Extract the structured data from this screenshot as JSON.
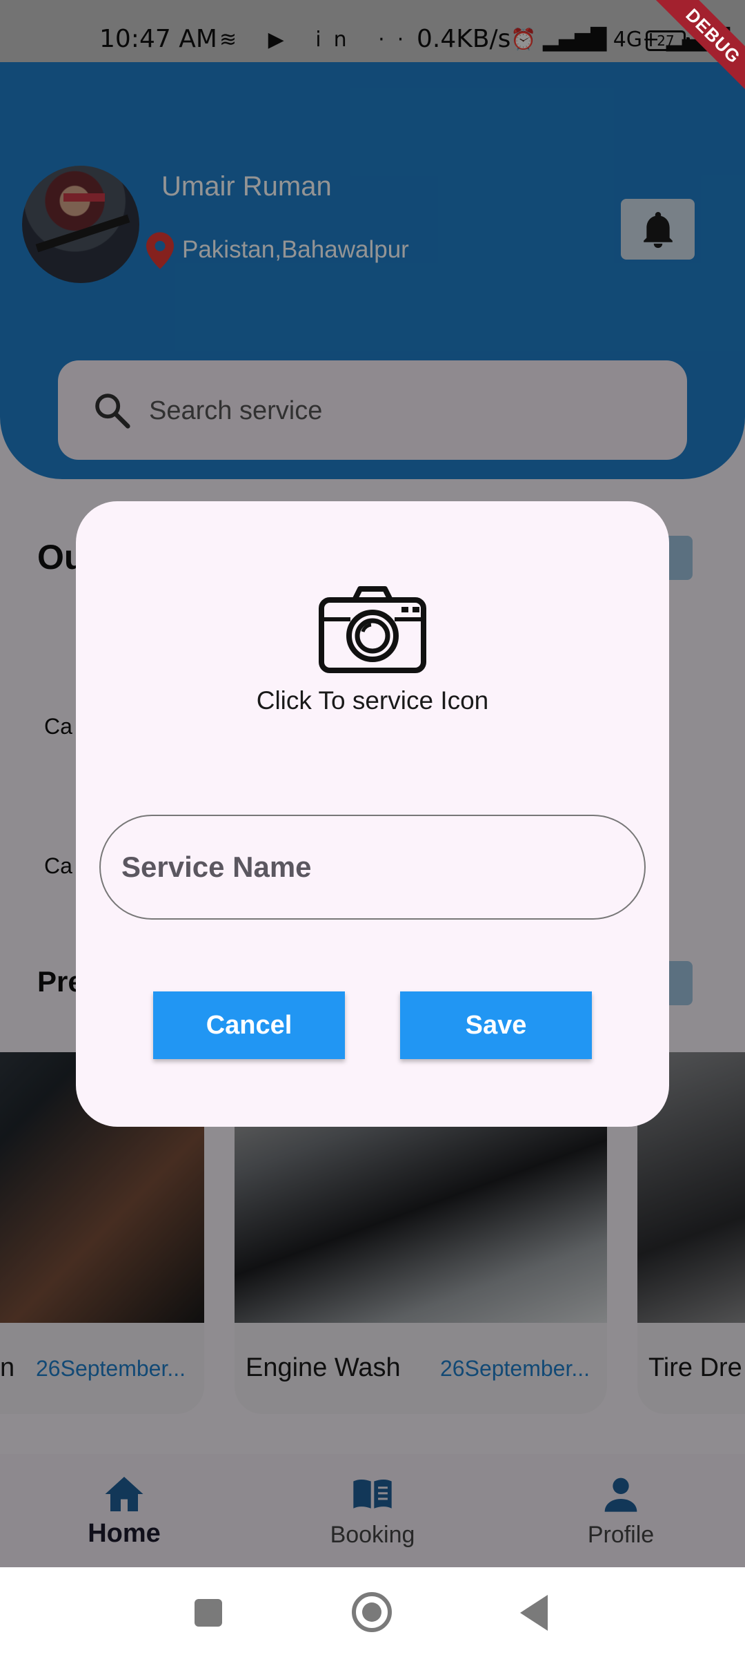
{
  "status_bar": {
    "time": "10:47 AM",
    "left_icons": "≋ ▶ in ···",
    "net_speed": "0.4KB/s",
    "right_icons": "⏰ ▂▄▆█ 4G+ ▂▄▆█",
    "battery": "27"
  },
  "debug_banner": "DEBUG",
  "header": {
    "user_name": "Umair Ruman",
    "location": "Pakistan,Bahawalpur",
    "search_placeholder": "Search service"
  },
  "background": {
    "section_1_title": "Ou",
    "category_1": "Ca",
    "category_2": "Ca",
    "section_2_title": "Pre",
    "cards": [
      {
        "title": "n",
        "date": "26September..."
      },
      {
        "title": "Engine Wash",
        "date": "26September..."
      },
      {
        "title": "Tire Dre",
        "date": ""
      }
    ]
  },
  "bottom_nav": {
    "items": [
      {
        "label": "Home",
        "icon": "home-icon",
        "active": true
      },
      {
        "label": "Booking",
        "icon": "book-icon",
        "active": false
      },
      {
        "label": "Profile",
        "icon": "person-icon",
        "active": false
      }
    ]
  },
  "dialog": {
    "caption": "Click To service Icon",
    "input_placeholder": "Service Name",
    "cancel_label": "Cancel",
    "save_label": "Save"
  },
  "colors": {
    "primary": "#1f7fca",
    "button": "#2196f3",
    "dialog_bg": "#fcf3fb"
  }
}
